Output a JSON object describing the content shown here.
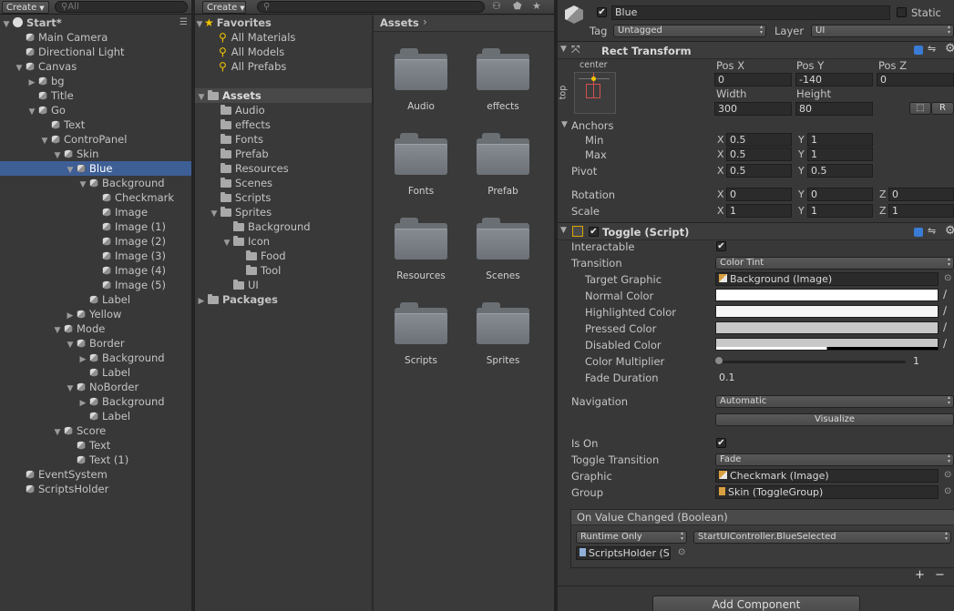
{
  "hierarchy": {
    "create_label": "Create",
    "search_placeholder": "All",
    "rows": [
      {
        "label": "Start*",
        "depth": 0,
        "expanded": true,
        "kind": "scene"
      },
      {
        "label": "Main Camera",
        "depth": 1,
        "kind": "go"
      },
      {
        "label": "Directional Light",
        "depth": 1,
        "kind": "go"
      },
      {
        "label": "Canvas",
        "depth": 1,
        "expanded": true,
        "kind": "go"
      },
      {
        "label": "bg",
        "depth": 2,
        "collapsed": true,
        "kind": "go"
      },
      {
        "label": "Title",
        "depth": 2,
        "kind": "go"
      },
      {
        "label": "Go",
        "depth": 2,
        "expanded": true,
        "kind": "go"
      },
      {
        "label": "Text",
        "depth": 3,
        "kind": "go"
      },
      {
        "label": "ControPanel",
        "depth": 3,
        "expanded": true,
        "kind": "go"
      },
      {
        "label": "Skin",
        "depth": 4,
        "expanded": true,
        "kind": "go"
      },
      {
        "label": "Blue",
        "depth": 5,
        "expanded": true,
        "kind": "go",
        "selected": true
      },
      {
        "label": "Background",
        "depth": 6,
        "expanded": true,
        "kind": "go"
      },
      {
        "label": "Checkmark",
        "depth": 7,
        "kind": "go"
      },
      {
        "label": "Image",
        "depth": 7,
        "kind": "go"
      },
      {
        "label": "Image (1)",
        "depth": 7,
        "kind": "go"
      },
      {
        "label": "Image (2)",
        "depth": 7,
        "kind": "go"
      },
      {
        "label": "Image (3)",
        "depth": 7,
        "kind": "go"
      },
      {
        "label": "Image (4)",
        "depth": 7,
        "kind": "go"
      },
      {
        "label": "Image (5)",
        "depth": 7,
        "kind": "go"
      },
      {
        "label": "Label",
        "depth": 6,
        "kind": "go"
      },
      {
        "label": "Yellow",
        "depth": 5,
        "collapsed": true,
        "kind": "go"
      },
      {
        "label": "Mode",
        "depth": 4,
        "expanded": true,
        "kind": "go"
      },
      {
        "label": "Border",
        "depth": 5,
        "expanded": true,
        "kind": "go"
      },
      {
        "label": "Background",
        "depth": 6,
        "collapsed": true,
        "kind": "go"
      },
      {
        "label": "Label",
        "depth": 6,
        "kind": "go"
      },
      {
        "label": "NoBorder",
        "depth": 5,
        "expanded": true,
        "kind": "go"
      },
      {
        "label": "Background",
        "depth": 6,
        "collapsed": true,
        "kind": "go"
      },
      {
        "label": "Label",
        "depth": 6,
        "kind": "go"
      },
      {
        "label": "Score",
        "depth": 4,
        "expanded": true,
        "kind": "go"
      },
      {
        "label": "Text",
        "depth": 5,
        "kind": "go"
      },
      {
        "label": "Text (1)",
        "depth": 5,
        "kind": "go"
      },
      {
        "label": "EventSystem",
        "depth": 1,
        "kind": "go"
      },
      {
        "label": "ScriptsHolder",
        "depth": 1,
        "kind": "go"
      }
    ]
  },
  "project": {
    "create_label": "Create",
    "favorites": {
      "title": "Favorites",
      "items": [
        "All Materials",
        "All Models",
        "All Prefabs"
      ]
    },
    "tree": [
      {
        "label": "Assets",
        "depth": 0,
        "expanded": true,
        "bold": true,
        "selected": true
      },
      {
        "label": "Audio",
        "depth": 1
      },
      {
        "label": "effects",
        "depth": 1
      },
      {
        "label": "Fonts",
        "depth": 1
      },
      {
        "label": "Prefab",
        "depth": 1
      },
      {
        "label": "Resources",
        "depth": 1
      },
      {
        "label": "Scenes",
        "depth": 1
      },
      {
        "label": "Scripts",
        "depth": 1
      },
      {
        "label": "Sprites",
        "depth": 1,
        "expanded": true
      },
      {
        "label": "Background",
        "depth": 2
      },
      {
        "label": "Icon",
        "depth": 2,
        "expanded": true
      },
      {
        "label": "Food",
        "depth": 3
      },
      {
        "label": "Tool",
        "depth": 3
      },
      {
        "label": "UI",
        "depth": 2
      },
      {
        "label": "Packages",
        "depth": 0,
        "collapsed": true,
        "bold": true
      }
    ],
    "breadcrumb": "Assets",
    "folders": [
      "Audio",
      "effects",
      "Fonts",
      "Prefab",
      "Resources",
      "Scenes",
      "Scripts",
      "Sprites"
    ]
  },
  "inspector": {
    "object_name": "Blue",
    "static_label": "Static",
    "tag_label": "Tag",
    "tag_value": "Untagged",
    "layer_label": "Layer",
    "layer_value": "UI",
    "rect": {
      "title": "Rect Transform",
      "anchor_h": "center",
      "anchor_v": "top",
      "pos_x_label": "Pos X",
      "pos_y_label": "Pos Y",
      "pos_z_label": "Pos Z",
      "pos_x": "0",
      "pos_y": "-140",
      "pos_z": "0",
      "width_label": "Width",
      "height_label": "Height",
      "width": "300",
      "height": "80",
      "r_button": "R",
      "anchors_label": "Anchors",
      "min_label": "Min",
      "max_label": "Max",
      "min_x": "0.5",
      "min_y": "1",
      "max_x": "0.5",
      "max_y": "1",
      "pivot_label": "Pivot",
      "pivot_x": "0.5",
      "pivot_y": "0.5",
      "rotation_label": "Rotation",
      "rot_x": "0",
      "rot_y": "0",
      "rot_z": "0",
      "scale_label": "Scale",
      "scale_x": "1",
      "scale_y": "1",
      "scale_z": "1",
      "x": "X",
      "y": "Y",
      "z": "Z"
    },
    "toggle": {
      "title": "Toggle (Script)",
      "interactable_label": "Interactable",
      "transition_label": "Transition",
      "transition_value": "Color Tint",
      "target_graphic_label": "Target Graphic",
      "target_graphic_value": "Background (Image)",
      "normal_color_label": "Normal Color",
      "highlighted_color_label": "Highlighted Color",
      "pressed_color_label": "Pressed Color",
      "disabled_color_label": "Disabled Color",
      "color_multiplier_label": "Color Multiplier",
      "color_multiplier_value": "1",
      "color_multiplier_fraction": 0,
      "fade_duration_label": "Fade Duration",
      "fade_duration_value": "0.1",
      "navigation_label": "Navigation",
      "navigation_value": "Automatic",
      "visualize_label": "Visualize",
      "is_on_label": "Is On",
      "toggle_transition_label": "Toggle Transition",
      "toggle_transition_value": "Fade",
      "graphic_label": "Graphic",
      "graphic_value": "Checkmark (Image)",
      "group_label": "Group",
      "group_value": "Skin (ToggleGroup)",
      "event_title": "On Value Changed (Boolean)",
      "event_runtime": "Runtime Only",
      "event_function": "StartUIController.BlueSelected",
      "event_object": "ScriptsHolder (S",
      "plus": "+",
      "minus": "−"
    },
    "add_component_label": "Add Component",
    "colors": {
      "normal": "#ffffff",
      "highlighted": "#f5f5f5",
      "pressed": "#c8c8c8",
      "disabled": "#c8c8c8",
      "selection": "#3e5f96"
    }
  }
}
